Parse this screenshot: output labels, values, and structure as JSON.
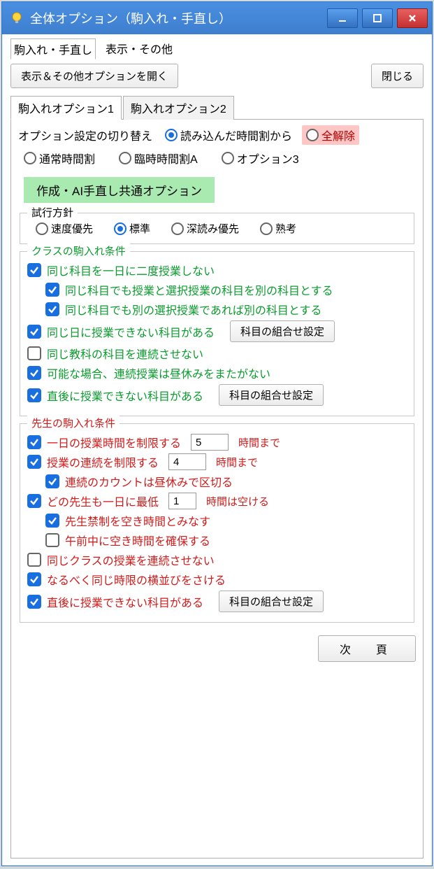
{
  "window": {
    "title": "全体オプション（駒入れ・手直し）"
  },
  "toptabs": {
    "tab1": "駒入れ・手直し",
    "tab2": "表示・その他"
  },
  "buttons": {
    "open_other": "表示＆その他オプションを開く",
    "close": "閉じる",
    "subject_combo": "科目の組合せ設定",
    "next_page": "次　頁"
  },
  "inner_tabs": {
    "t1": "駒入れオプション1",
    "t2": "駒入れオプション2"
  },
  "switch": {
    "title": "オプション設定の切り替え",
    "from_loaded": "読み込んだ時間割から",
    "clear_all": "全解除",
    "normal": "通常時間割",
    "tempA": "臨時時間割A",
    "opt3": "オプション3"
  },
  "common_head": "作成・AI手直し共通オプション",
  "policy": {
    "legend": "試行方針",
    "speed": "速度優先",
    "standard": "標準",
    "deep": "深読み優先",
    "think": "熟考"
  },
  "class_group": {
    "legend": "クラスの駒入れ条件",
    "c1": "同じ科目を一日に二度授業しない",
    "c1a": "同じ科目でも授業と選択授業の科目を別の科目とする",
    "c1b": "同じ科目でも別の選択授業であれば別の科目とする",
    "c2": "同じ日に授業できない科目がある",
    "c3": "同じ教科の科目を連続させない",
    "c4": "可能な場合、連続授業は昼休みをまたがない",
    "c5": "直後に授業できない科目がある"
  },
  "teacher_group": {
    "legend": "先生の駒入れ条件",
    "t1": "一日の授業時間を制限する",
    "t1_val": "5",
    "t1_unit": "時間まで",
    "t2": "授業の連続を制限する",
    "t2_val": "4",
    "t2_unit": "時間まで",
    "t2a": "連続のカウントは昼休みで区切る",
    "t3a": "どの先生も一日に最低",
    "t3_val": "1",
    "t3b": "時間は空ける",
    "t3sub1": "先生禁制を空き時間とみなす",
    "t3sub2": "午前中に空き時間を確保する",
    "t4": "同じクラスの授業を連続させない",
    "t5": "なるべく同じ時限の横並びをさける",
    "t6": "直後に授業できない科目がある"
  }
}
